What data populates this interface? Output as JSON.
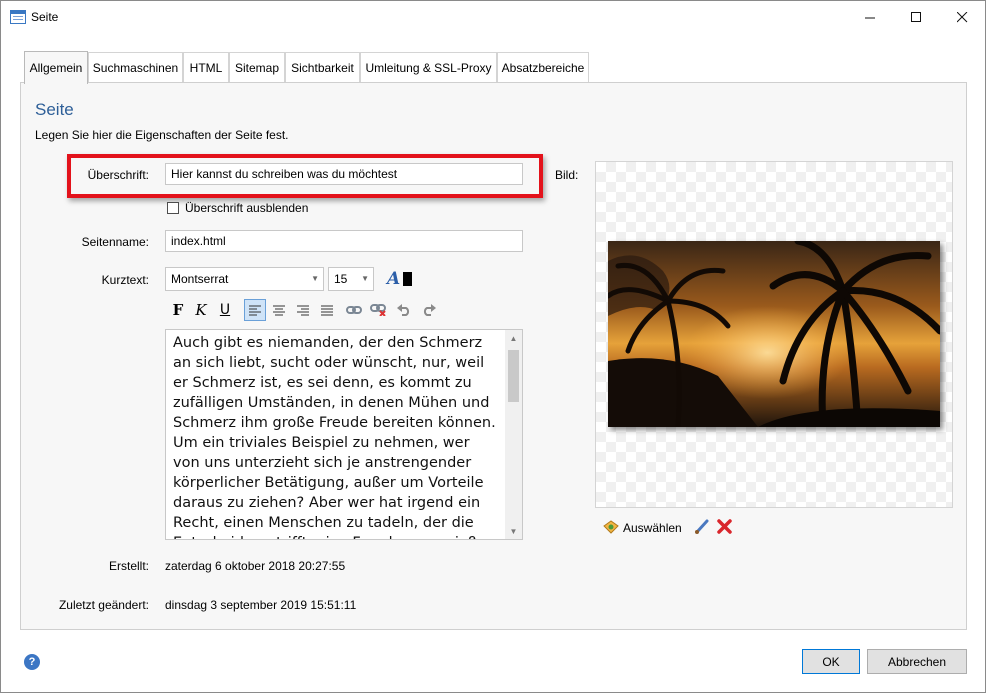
{
  "window": {
    "title": "Seite",
    "minimize": "—",
    "maximize": "☐",
    "close": "✕"
  },
  "tabs": [
    {
      "label": "Allgemein",
      "active": true
    },
    {
      "label": "Suchmaschinen"
    },
    {
      "label": "HTML"
    },
    {
      "label": "Sitemap"
    },
    {
      "label": "Sichtbarkeit"
    },
    {
      "label": "Umleitung & SSL-Proxy"
    },
    {
      "label": "Absatzbereiche"
    }
  ],
  "page": {
    "heading": "Seite",
    "description": "Legen Sie hier die Eigenschaften der Seite fest."
  },
  "form": {
    "title_label": "Überschrift:",
    "title_value": "Hier kannst du schreiben was du möchtest",
    "hide_title_label": "Überschrift ausblenden",
    "hide_title_checked": false,
    "pagename_label": "Seitenname:",
    "pagename_value": "index.html",
    "summary_label": "Kurztext:",
    "font_value": "Montserrat",
    "size_value": "15",
    "summary_text": "Auch gibt es niemanden, der den Schmerz an sich liebt, sucht oder wünscht, nur, weil er Schmerz ist, es sei denn, es kommt zu zufälligen Umständen, in denen Mühen und Schmerz ihm große Freude bereiten können. Um ein triviales Beispiel zu nehmen, wer von uns unterzieht sich je anstrengender körperlicher Betätigung, außer um Vorteile daraus zu ziehen? Aber wer hat irgend ein Recht, einen Menschen zu tadeln, der die Entscheidung trifft, eine Freude zu genießen",
    "created_label": "Erstellt:",
    "created_value": "zaterdag 6 oktober 2018 20:27:55",
    "modified_label": "Zuletzt geändert:",
    "modified_value": "dinsdag 3 september 2019 15:51:11",
    "image_label": "Bild:",
    "select_label": "Auswählen"
  },
  "toolbar": {
    "bold": "F",
    "italic": "K",
    "underline": "U",
    "font_color_letter": "A",
    "font_color": "#000000"
  },
  "footer": {
    "ok": "OK",
    "cancel": "Abbrechen",
    "help": "?"
  },
  "colors": {
    "accent": "#2e5f98",
    "highlight": "#e3121b"
  }
}
